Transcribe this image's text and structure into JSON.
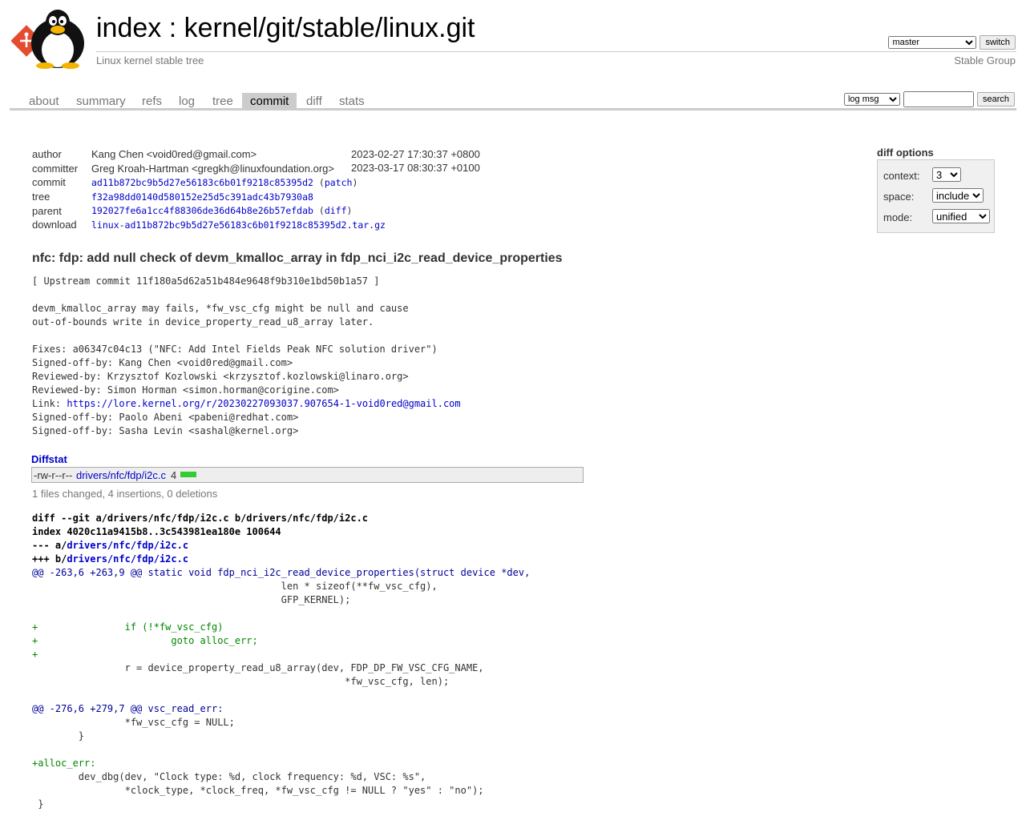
{
  "header": {
    "title_prefix": "index",
    "title_sep": " : ",
    "title_repo": "kernel/git/stable/linux.git",
    "subtitle": "Linux kernel stable tree",
    "owner": "Stable Group",
    "branch_selected": "master",
    "switch_label": "switch"
  },
  "tabs": [
    "about",
    "summary",
    "refs",
    "log",
    "tree",
    "commit",
    "diff",
    "stats"
  ],
  "active_tab": "commit",
  "search": {
    "scope_selected": "log msg",
    "query": "",
    "button_label": "search"
  },
  "commit": {
    "author_label": "author",
    "author": "Kang Chen <void0red@gmail.com>",
    "author_date": "2023-02-27 17:30:37 +0800",
    "committer_label": "committer",
    "committer": "Greg Kroah-Hartman <gregkh@linuxfoundation.org>",
    "committer_date": "2023-03-17 08:30:37 +0100",
    "commit_label": "commit",
    "commit_hash": "ad11b872bc9b5d27e56183c6b01f9218c85395d2",
    "patch_link": "patch",
    "tree_label": "tree",
    "tree_hash": "f32a98dd0140d580152e25d5c391adc43b7930a8",
    "parent_label": "parent",
    "parent_hash": "192027fe6a1cc4f88306de36d64b8e26b57efdab",
    "diff_link": "diff",
    "download_label": "download",
    "download_file": "linux-ad11b872bc9b5d27e56183c6b01f9218c85395d2.tar.gz",
    "subject": "nfc: fdp: add null check of devm_kmalloc_array in fdp_nci_i2c_read_device_properties",
    "message_before_link": "[ Upstream commit 11f180a5d62a51b484e9648f9b310e1bd50b1a57 ]\n\ndevm_kmalloc_array may fails, *fw_vsc_cfg might be null and cause\nout-of-bounds write in device_property_read_u8_array later.\n\nFixes: a06347c04c13 (\"NFC: Add Intel Fields Peak NFC solution driver\")\nSigned-off-by: Kang Chen <void0red@gmail.com>\nReviewed-by: Krzysztof Kozlowski <krzysztof.kozlowski@linaro.org>\nReviewed-by: Simon Horman <simon.horman@corigine.com>\nLink: ",
    "message_link": "https://lore.kernel.org/r/20230227093037.907654-1-void0red@gmail.com",
    "message_after_link": "\nSigned-off-by: Paolo Abeni <pabeni@redhat.com>\nSigned-off-by: Sasha Levin <sashal@kernel.org>"
  },
  "diff_options": {
    "title": "diff options",
    "context_label": "context:",
    "context_value": "3",
    "space_label": "space:",
    "space_value": "include",
    "mode_label": "mode:",
    "mode_value": "unified"
  },
  "diffstat": {
    "title": "Diffstat",
    "mode": "-rw-r--r--",
    "file": "drivers/nfc/fdp/i2c.c",
    "changes": "4",
    "added_fraction": 1.0,
    "bar_color": "#33cc33",
    "summary": "1 files changed, 4 insertions, 0 deletions"
  },
  "diff": {
    "git_line": "diff --git a/drivers/nfc/fdp/i2c.c b/drivers/nfc/fdp/i2c.c",
    "index_line": "index 4020c11a9415b8..3c543981ea180e 100644",
    "minus_prefix": "--- a/",
    "plus_prefix": "+++ b/",
    "file_path": "drivers/nfc/fdp/i2c.c",
    "lines": [
      {
        "t": "hunk",
        "s": "@@ -263,6 +263,9 @@ static void fdp_nci_i2c_read_device_properties(struct device *dev,"
      },
      {
        "t": "ctx",
        "s": "\t\t\t\t\t   len * sizeof(**fw_vsc_cfg),"
      },
      {
        "t": "ctx",
        "s": "\t\t\t\t\t   GFP_KERNEL);"
      },
      {
        "t": "ctx",
        "s": ""
      },
      {
        "t": "add",
        "s": "+\t\tif (!*fw_vsc_cfg)"
      },
      {
        "t": "add",
        "s": "+\t\t\tgoto alloc_err;"
      },
      {
        "t": "add",
        "s": "+"
      },
      {
        "t": "ctx",
        "s": " \t\tr = device_property_read_u8_array(dev, FDP_DP_FW_VSC_CFG_NAME,"
      },
      {
        "t": "ctx",
        "s": " \t\t\t\t\t\t      *fw_vsc_cfg, len);"
      },
      {
        "t": "ctx",
        "s": ""
      },
      {
        "t": "hunk",
        "s": "@@ -276,6 +279,7 @@ vsc_read_err:"
      },
      {
        "t": "ctx",
        "s": " \t\t*fw_vsc_cfg = NULL;"
      },
      {
        "t": "ctx",
        "s": " \t}"
      },
      {
        "t": "ctx",
        "s": ""
      },
      {
        "t": "add",
        "s": "+alloc_err:"
      },
      {
        "t": "ctx",
        "s": " \tdev_dbg(dev, \"Clock type: %d, clock frequency: %d, VSC: %s\","
      },
      {
        "t": "ctx",
        "s": " \t\t*clock_type, *clock_freq, *fw_vsc_cfg != NULL ? \"yes\" : \"no\");"
      },
      {
        "t": "ctx",
        "s": " }"
      }
    ]
  }
}
